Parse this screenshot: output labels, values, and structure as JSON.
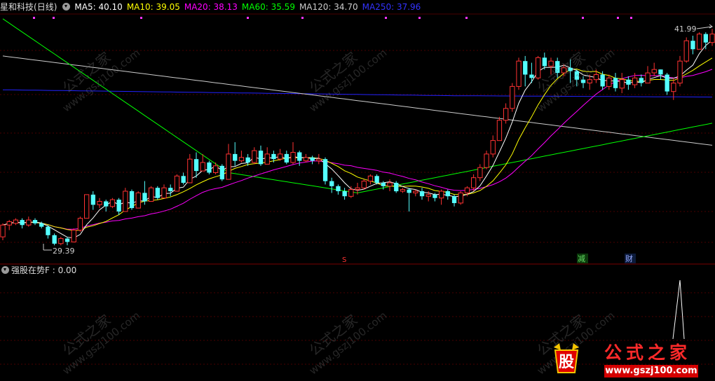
{
  "header": {
    "stock_name": "星和科技",
    "period": "(日线)",
    "ma5": "MA5: 40.10",
    "ma10": "MA10: 39.05",
    "ma20": "MA20: 38.13",
    "ma60": "MA60: 35.59",
    "ma120": "MA120: 34.70",
    "ma250": "MA250: 37.96"
  },
  "colors": {
    "ma5": "#ffffff",
    "ma10": "#ffff00",
    "ma20": "#ff00ff",
    "ma60": "#00ff00",
    "ma120": "#cccccc",
    "ma250": "#2222ff",
    "up": "#ff3232",
    "down": "#54ffff"
  },
  "price_labels": {
    "high": "41.99",
    "low": "29.39"
  },
  "events": {
    "s_marker": "S",
    "reduce": "减",
    "finance": "财"
  },
  "indicator": {
    "title": "强股在势F : 0.00"
  },
  "watermark": {
    "cn": "公式之家",
    "url": "www.gszj100.com"
  },
  "logo": {
    "cn": "公式之家",
    "url": "www.gszj100.com",
    "badge": "股"
  },
  "chart_data": {
    "type": "candlestick",
    "price_range": [
      28.5,
      43.0
    ],
    "candles": [
      [
        29.9,
        30.6,
        29.7,
        30.7
      ],
      [
        30.6,
        30.8,
        30.3,
        30.9
      ],
      [
        30.7,
        30.9,
        30.6,
        31.0
      ],
      [
        30.9,
        30.6,
        30.4,
        31.0
      ],
      [
        30.6,
        30.9,
        30.5,
        31.1
      ],
      [
        30.9,
        30.7,
        30.6,
        31.0
      ],
      [
        30.7,
        30.5,
        30.4,
        30.8
      ],
      [
        30.5,
        30.0,
        29.8,
        30.6
      ],
      [
        30.0,
        29.5,
        29.4,
        30.1
      ],
      [
        29.5,
        29.8,
        29.4,
        29.9
      ],
      [
        29.8,
        29.6,
        29.4,
        29.9
      ],
      [
        29.6,
        30.3,
        29.6,
        30.4
      ],
      [
        30.3,
        31.0,
        30.2,
        31.1
      ],
      [
        31.0,
        32.4,
        31.0,
        32.4
      ],
      [
        32.4,
        31.8,
        31.5,
        32.6
      ],
      [
        31.8,
        32.0,
        31.6,
        32.2
      ],
      [
        32.0,
        31.7,
        31.4,
        32.1
      ],
      [
        31.7,
        32.1,
        31.6,
        32.2
      ],
      [
        32.1,
        31.4,
        31.2,
        32.2
      ],
      [
        31.4,
        32.6,
        31.4,
        32.8
      ],
      [
        32.6,
        31.6,
        31.5,
        32.7
      ],
      [
        31.6,
        32.5,
        31.6,
        32.6
      ],
      [
        32.5,
        32.0,
        31.8,
        33.2
      ],
      [
        32.0,
        32.8,
        32.0,
        32.9
      ],
      [
        32.8,
        32.2,
        32.1,
        32.9
      ],
      [
        32.2,
        32.8,
        32.2,
        33.0
      ],
      [
        32.8,
        32.6,
        32.3,
        33.0
      ],
      [
        32.6,
        33.5,
        32.6,
        33.6
      ],
      [
        33.5,
        33.1,
        33.0,
        33.7
      ],
      [
        33.1,
        34.5,
        33.1,
        34.8
      ],
      [
        34.5,
        33.8,
        33.4,
        34.9
      ],
      [
        33.8,
        34.3,
        33.8,
        34.8
      ],
      [
        34.3,
        33.7,
        33.6,
        34.4
      ],
      [
        33.7,
        34.1,
        33.6,
        34.3
      ],
      [
        34.1,
        33.3,
        33.2,
        34.2
      ],
      [
        33.3,
        34.8,
        33.3,
        35.4
      ],
      [
        34.8,
        34.4,
        34.1,
        35.5
      ],
      [
        34.4,
        34.6,
        34.3,
        35.0
      ],
      [
        34.6,
        34.3,
        34.1,
        34.8
      ],
      [
        34.3,
        35.0,
        34.2,
        35.2
      ],
      [
        35.0,
        34.2,
        34.1,
        35.3
      ],
      [
        34.2,
        34.8,
        34.2,
        35.2
      ],
      [
        34.8,
        34.5,
        34.3,
        35.0
      ],
      [
        34.5,
        34.8,
        34.4,
        35.1
      ],
      [
        34.8,
        34.3,
        34.2,
        35.0
      ],
      [
        34.3,
        34.9,
        34.2,
        35.5
      ],
      [
        34.9,
        34.4,
        34.1,
        35.0
      ],
      [
        34.4,
        34.6,
        34.3,
        34.8
      ],
      [
        34.6,
        34.4,
        34.2,
        34.7
      ],
      [
        34.4,
        34.5,
        34.2,
        34.8
      ],
      [
        34.5,
        33.2,
        33.0,
        34.6
      ],
      [
        33.2,
        32.9,
        32.5,
        33.4
      ],
      [
        32.9,
        32.6,
        32.4,
        33.0
      ],
      [
        32.6,
        32.3,
        32.1,
        32.8
      ],
      [
        32.3,
        32.7,
        32.2,
        32.9
      ],
      [
        32.7,
        32.8,
        32.4,
        33.1
      ],
      [
        32.8,
        33.2,
        32.7,
        33.3
      ],
      [
        33.2,
        33.5,
        33.0,
        33.6
      ],
      [
        33.5,
        33.1,
        33.0,
        33.6
      ],
      [
        33.1,
        32.9,
        32.7,
        33.2
      ],
      [
        32.9,
        33.1,
        32.6,
        33.3
      ],
      [
        33.1,
        32.6,
        32.5,
        33.2
      ],
      [
        32.6,
        32.7,
        32.5,
        32.8
      ],
      [
        32.7,
        32.5,
        31.4,
        32.8
      ],
      [
        32.5,
        32.6,
        32.3,
        32.7
      ],
      [
        32.6,
        32.3,
        32.1,
        32.8
      ],
      [
        32.3,
        32.4,
        32.0,
        32.6
      ],
      [
        32.4,
        32.2,
        32.0,
        32.5
      ],
      [
        32.2,
        32.6,
        31.8,
        32.7
      ],
      [
        32.6,
        32.3,
        32.1,
        32.7
      ],
      [
        32.3,
        31.9,
        31.7,
        32.4
      ],
      [
        31.9,
        32.5,
        31.8,
        32.6
      ],
      [
        32.5,
        32.8,
        32.3,
        32.9
      ],
      [
        32.8,
        33.4,
        32.6,
        33.6
      ],
      [
        33.4,
        34.0,
        33.2,
        34.2
      ],
      [
        34.0,
        34.8,
        33.9,
        35.0
      ],
      [
        34.8,
        35.6,
        34.6,
        35.9
      ],
      [
        35.6,
        36.8,
        35.6,
        37.0
      ],
      [
        36.8,
        37.5,
        36.6,
        37.8
      ],
      [
        37.5,
        38.8,
        37.3,
        39.0
      ],
      [
        38.8,
        40.3,
        38.6,
        40.5
      ],
      [
        40.3,
        39.5,
        38.8,
        40.6
      ],
      [
        39.5,
        39.3,
        39.0,
        40.2
      ],
      [
        39.3,
        40.5,
        39.2,
        40.6
      ],
      [
        40.5,
        40.0,
        39.8,
        40.8
      ],
      [
        40.0,
        40.3,
        39.5,
        40.5
      ],
      [
        40.3,
        39.6,
        39.3,
        40.5
      ],
      [
        39.6,
        39.9,
        39.4,
        40.1
      ],
      [
        39.9,
        39.7,
        39.0,
        40.4
      ],
      [
        39.7,
        39.2,
        38.8,
        39.8
      ],
      [
        39.2,
        39.0,
        38.7,
        39.4
      ],
      [
        39.0,
        39.2,
        38.6,
        39.5
      ],
      [
        39.2,
        39.5,
        39.0,
        39.8
      ],
      [
        39.5,
        38.8,
        38.6,
        39.7
      ],
      [
        38.8,
        39.3,
        38.6,
        39.5
      ],
      [
        39.3,
        38.7,
        38.5,
        39.6
      ],
      [
        38.7,
        39.2,
        38.4,
        39.6
      ],
      [
        39.2,
        38.9,
        38.6,
        39.4
      ],
      [
        38.9,
        39.3,
        38.7,
        39.6
      ],
      [
        39.3,
        39.0,
        38.8,
        39.5
      ],
      [
        39.0,
        39.6,
        39.0,
        40.0
      ],
      [
        39.6,
        39.8,
        39.4,
        40.2
      ],
      [
        39.8,
        39.5,
        39.2,
        39.8
      ],
      [
        39.5,
        38.5,
        38.3,
        39.6
      ],
      [
        38.5,
        39.0,
        38.0,
        39.3
      ],
      [
        39.0,
        40.3,
        38.8,
        40.6
      ],
      [
        40.3,
        41.5,
        40.2,
        41.7
      ],
      [
        41.5,
        41.0,
        40.7,
        41.8
      ],
      [
        41.0,
        41.9,
        41.0,
        42.0
      ],
      [
        41.9,
        41.4,
        41.0,
        42.0
      ],
      [
        41.4,
        41.9,
        41.2,
        42.2
      ]
    ]
  }
}
